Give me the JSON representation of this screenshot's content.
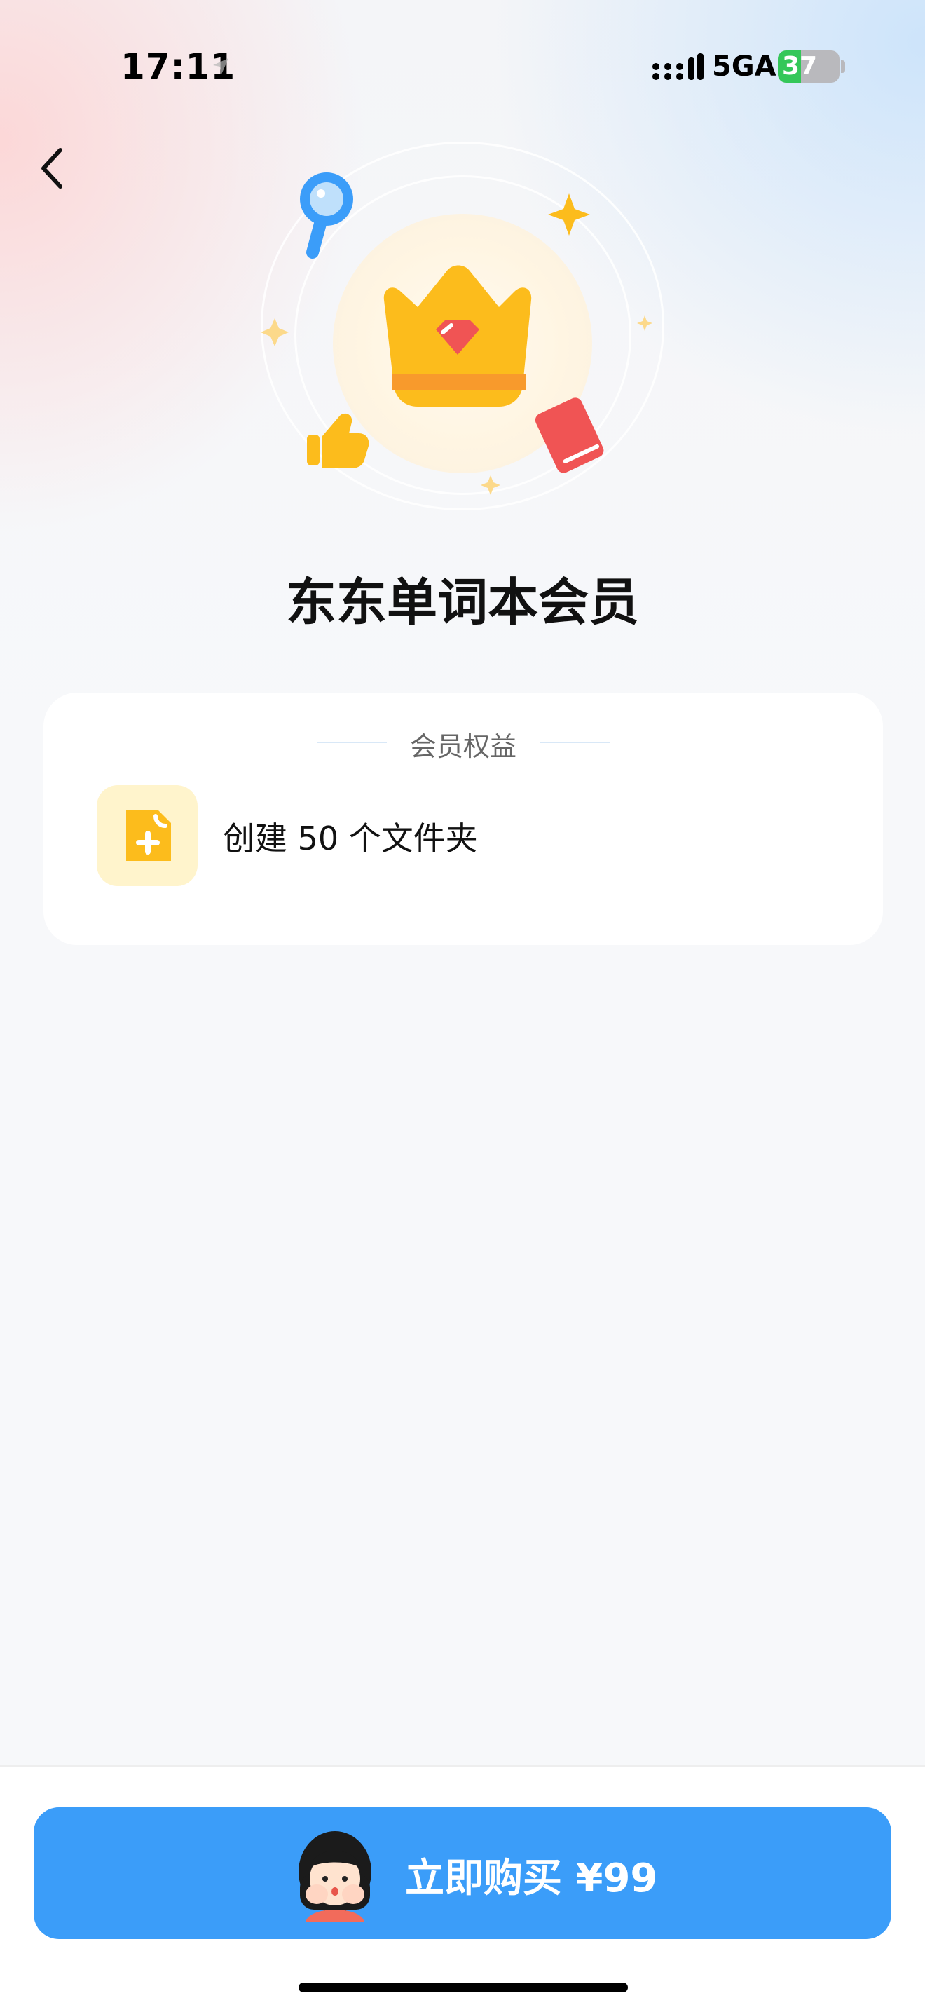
{
  "status_bar": {
    "time": "17:11",
    "network": "5GA",
    "battery_level": "37",
    "battery_fraction": 0.37
  },
  "nav": {
    "back_icon": "chevron-left-icon"
  },
  "hero": {
    "icons": [
      "crown-icon",
      "magnifier-icon",
      "book-icon",
      "thumbs-up-icon",
      "sparkle-icon"
    ]
  },
  "page": {
    "title": "东东单词本会员"
  },
  "benefits": {
    "header": "会员权益",
    "items": [
      {
        "icon": "add-file-icon",
        "label": "创建 50 个文件夹"
      }
    ]
  },
  "purchase": {
    "button_label": "立即购买 ¥99",
    "mascot_icon": "girl-avatar-icon"
  },
  "colors": {
    "accent": "#3b9df9",
    "gold": "#fcbc1c",
    "battery_green": "#34c759"
  }
}
